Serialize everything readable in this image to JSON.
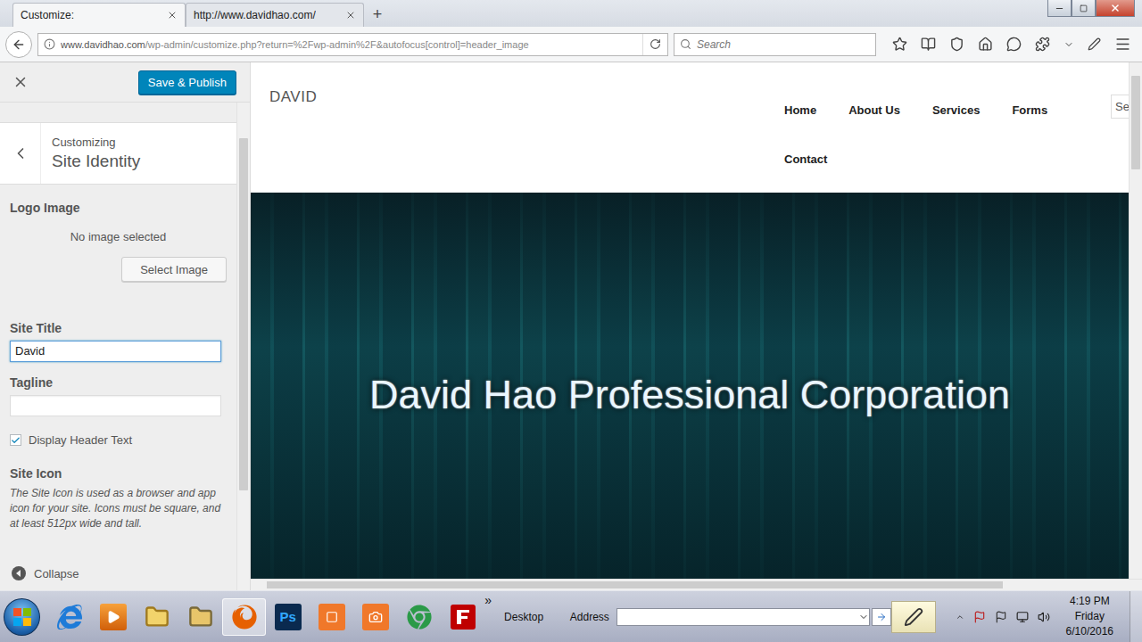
{
  "browser": {
    "tabs": [
      {
        "label": "Customize:",
        "selected": true
      },
      {
        "label": "http://www.davidhao.com/",
        "selected": false
      }
    ],
    "new_tab": "+",
    "url_host": "www.davidhao.com",
    "url_path": "/wp-admin/customize.php?return=%2Fwp-admin%2F&autofocus[control]=header_image",
    "search_placeholder": "Search"
  },
  "customizer": {
    "save_button": "Save & Publish",
    "section_kicker": "Customizing",
    "section_title": "Site Identity",
    "logo_label": "Logo Image",
    "logo_empty": "No image selected",
    "select_button": "Select Image",
    "site_title_label": "Site Title",
    "site_title_value": "David",
    "tagline_label": "Tagline",
    "tagline_value": "",
    "display_header_text": {
      "label": "Display Header Text",
      "checked": true
    },
    "site_icon_label": "Site Icon",
    "site_icon_help": "The Site Icon is used as a browser and app icon for your site. Icons must be square, and at least 512px wide and tall.",
    "collapse": "Collapse"
  },
  "preview": {
    "logo": "DAVID",
    "nav": [
      "Home",
      "About Us",
      "Services",
      "Forms",
      "Contact"
    ],
    "search_stub": "Se",
    "hero_title": "David Hao Professional Corporation"
  },
  "taskbar": {
    "apps": [
      {
        "kind": "ie",
        "active": false
      },
      {
        "kind": "media",
        "active": false
      },
      {
        "kind": "folder",
        "active": false
      },
      {
        "kind": "explorer",
        "active": false
      },
      {
        "kind": "firefox",
        "active": true
      },
      {
        "kind": "photoshop",
        "label": "Ps",
        "active": false
      },
      {
        "kind": "orange",
        "active": false
      },
      {
        "kind": "camera",
        "active": false
      },
      {
        "kind": "chrome",
        "active": false
      },
      {
        "kind": "filezilla",
        "active": false
      }
    ],
    "overflow": "»",
    "desktop": "Desktop",
    "address_label": "Address",
    "clock": {
      "time": "4:19 PM",
      "day": "Friday",
      "date": "6/10/2016"
    }
  }
}
